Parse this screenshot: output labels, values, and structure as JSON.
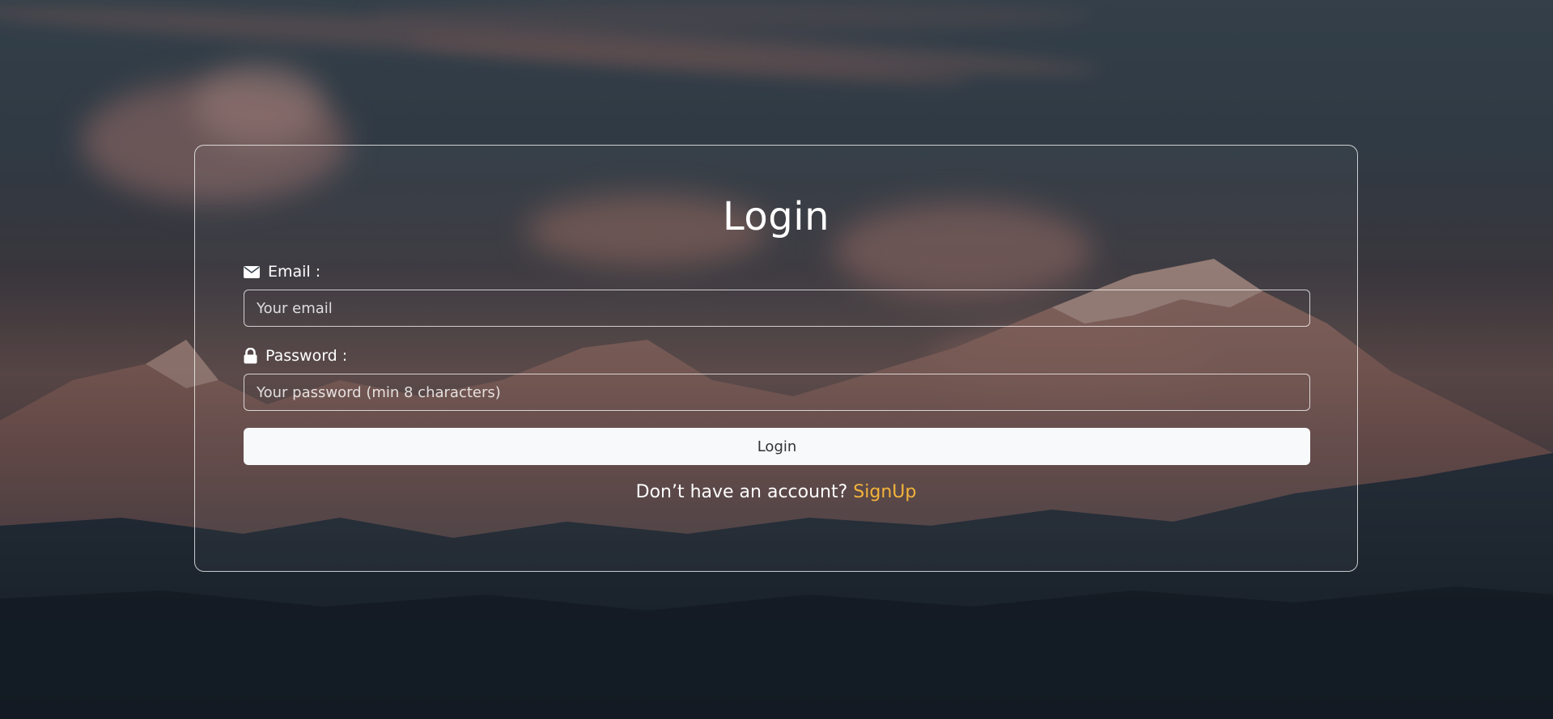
{
  "page": {
    "title": "Login"
  },
  "form": {
    "email": {
      "label": "Email :",
      "icon": "envelope-icon",
      "placeholder": "Your email",
      "value": ""
    },
    "password": {
      "label": "Password :",
      "icon": "lock-icon",
      "placeholder": "Your password (min 8 characters)",
      "value": ""
    },
    "submit_label": "Login"
  },
  "footer": {
    "prompt": "Don’t have an account?",
    "signup_label": "SignUp"
  },
  "colors": {
    "link": "#f3b43a",
    "button_bg": "#f8f9fa",
    "button_text": "#333333",
    "border": "#ffffff"
  }
}
